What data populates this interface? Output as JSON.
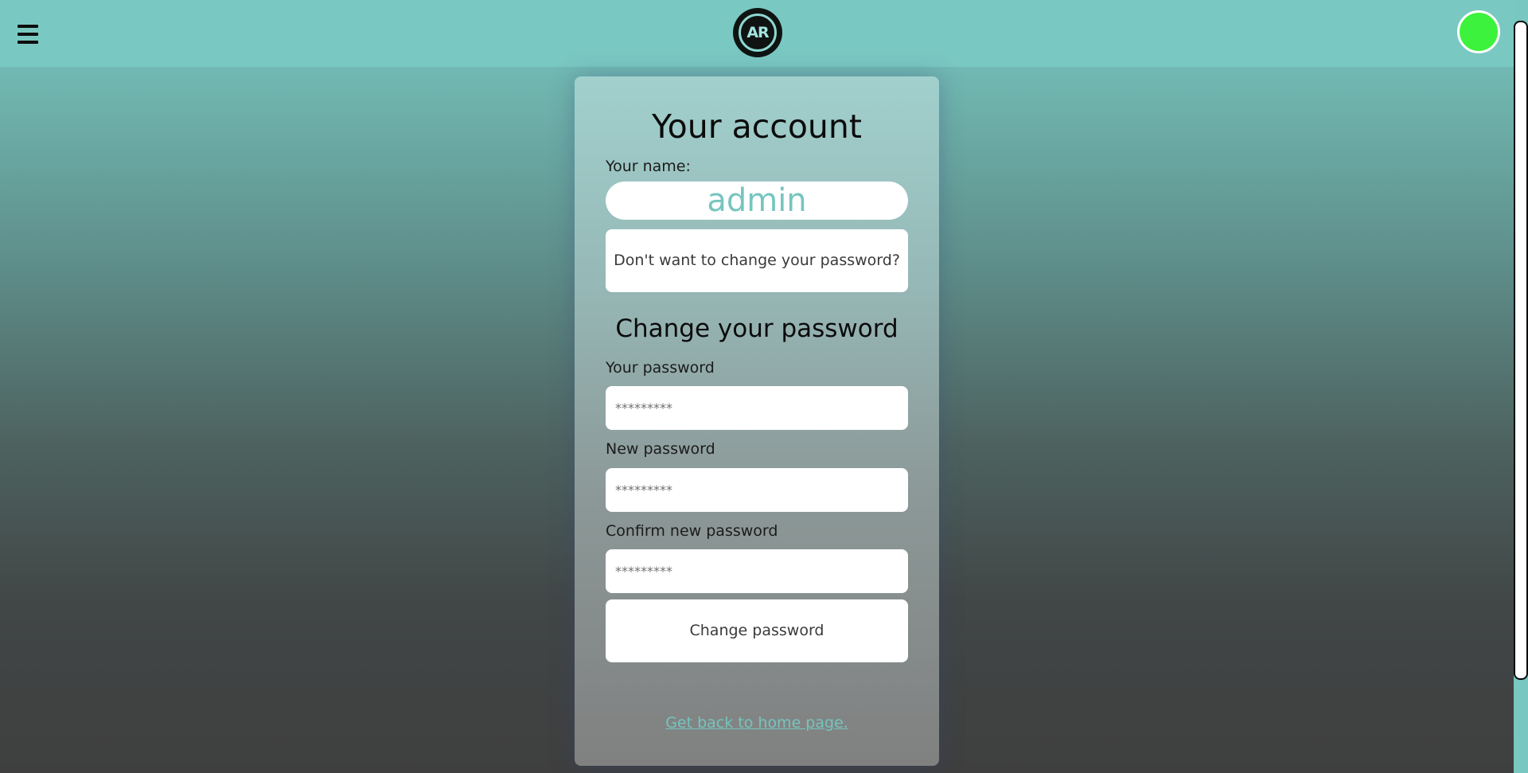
{
  "header": {
    "logo_text": "AR",
    "avatar_color": "#3df23d",
    "background_color": "#7ac8c2"
  },
  "account": {
    "title": "Your account",
    "name_label": "Your name:",
    "name_value": "admin",
    "skip_button_label": "Don't want to change your password?"
  },
  "change_password": {
    "title": "Change your password",
    "current_label": "Your password",
    "current_placeholder": "*********",
    "new_label": "New password",
    "new_placeholder": "*********",
    "confirm_label": "Confirm new password",
    "confirm_placeholder": "*********",
    "submit_label": "Change password"
  },
  "footer_link": "Get back to home page.",
  "icons": {
    "menu": "hamburger-menu-icon",
    "logo": "ar-logo-icon",
    "avatar": "user-avatar"
  }
}
